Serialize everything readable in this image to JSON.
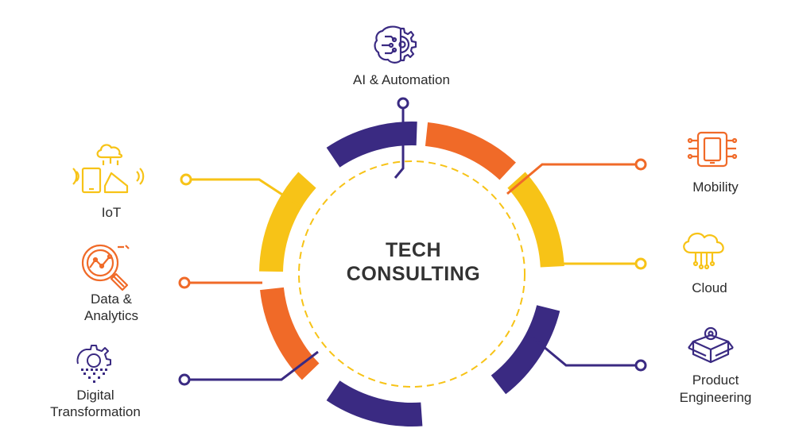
{
  "center": {
    "line1": "TECH",
    "line2": "CONSULTING"
  },
  "nodes": [
    {
      "id": "ai",
      "label": "AI & Automation",
      "icon": "brain-gear-icon",
      "color": "#3a2a82"
    },
    {
      "id": "mobility",
      "label": "Mobility",
      "icon": "mobile-circuit-icon",
      "color": "#f06a28"
    },
    {
      "id": "cloud",
      "label": "Cloud",
      "icon": "cloud-network-icon",
      "color": "#f7c317"
    },
    {
      "id": "product",
      "label_lines": [
        "Product",
        "Engineering"
      ],
      "icon": "box-gear-icon",
      "color": "#3a2a82"
    },
    {
      "id": "iot",
      "label": "IoT",
      "icon": "iot-home-device-icon",
      "color": "#f7c317"
    },
    {
      "id": "data",
      "label_lines": [
        "Data &",
        "Analytics"
      ],
      "icon": "magnifier-chart-icon",
      "color": "#f06a28"
    },
    {
      "id": "digital",
      "label_lines": [
        "Digital",
        "Transformation"
      ],
      "icon": "gear-pixels-icon",
      "color": "#3a2a82"
    }
  ],
  "colors": {
    "purple": "#3a2a82",
    "orange": "#f06a28",
    "yellow": "#f7c317",
    "dashed": "#f7c317"
  }
}
